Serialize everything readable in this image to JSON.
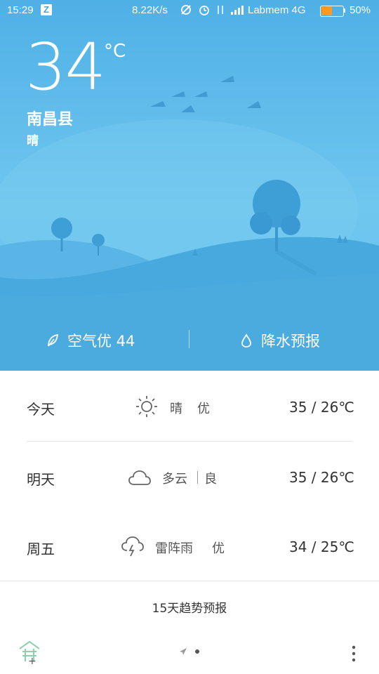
{
  "status_bar": {
    "time": "15:29",
    "app_icon_letter": "Z",
    "net_speed": "8.22K/s",
    "carrier": "Labmem 4G",
    "battery_percent": "50%",
    "battery_level": 0.5,
    "battery_color": "#ff9a1f",
    "icons": [
      "sync-off-icon",
      "alarm-icon",
      "data-arrows-icon",
      "signal-icon"
    ]
  },
  "current": {
    "temperature": "34",
    "unit": "°C",
    "city": "南昌县",
    "condition": "晴"
  },
  "actions": {
    "air_quality": "空气优 44",
    "precip": "降水预报"
  },
  "forecast": [
    {
      "day": "今天",
      "weather": "晴",
      "air": "优",
      "temps": "35 / 26℃",
      "icon": "sun-icon"
    },
    {
      "day": "明天",
      "weather": "多云",
      "air": "良",
      "temps": "35 / 26℃",
      "icon": "cloud-icon"
    },
    {
      "day": "周五",
      "weather": "雷阵雨",
      "air": "优",
      "temps": "34 / 25℃",
      "icon": "thunderstorm-icon"
    }
  ],
  "trend_link": "15天趋势预报",
  "colors": {
    "sky_top": "#4fb0e6",
    "sky_bottom": "#68c2ee",
    "hill": "#47a9dd"
  }
}
